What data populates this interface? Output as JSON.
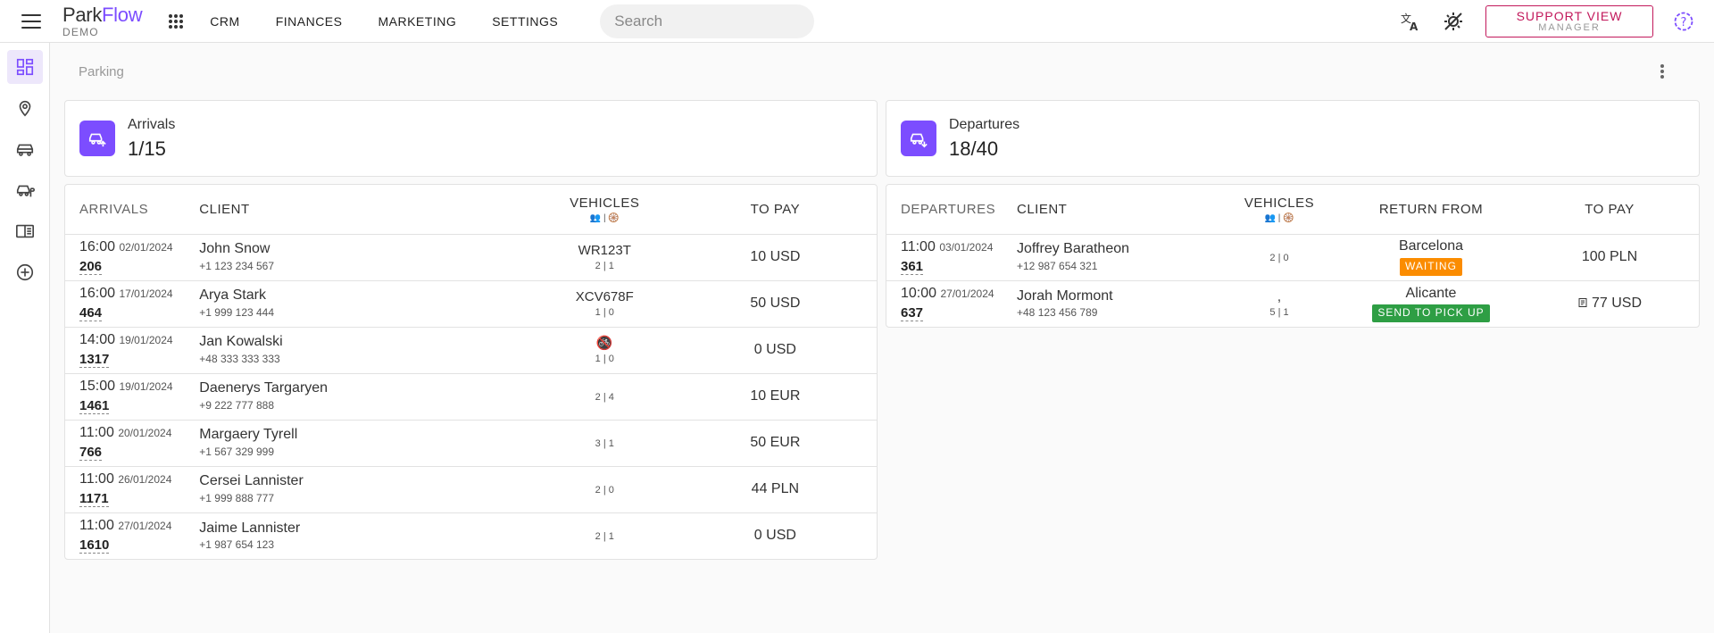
{
  "header": {
    "logo_part1": "Park",
    "logo_part2": "Flow",
    "logo_sub": "DEMO",
    "nav": [
      "CRM",
      "FINANCES",
      "MARKETING",
      "SETTINGS"
    ],
    "search_placeholder": "Search",
    "support_line1": "SUPPORT VIEW",
    "support_line2": "MANAGER"
  },
  "page": {
    "breadcrumb": "Parking"
  },
  "arrivals_stat": {
    "label": "Arrivals",
    "value": "1/15"
  },
  "departures_stat": {
    "label": "Departures",
    "value": "18/40"
  },
  "arrivals_table": {
    "columns": [
      "ARRIVALS",
      "CLIENT",
      "VEHICLES",
      "TO PAY"
    ],
    "vehicles_sub": "👥 | 🛞",
    "rows": [
      {
        "time": "16:00",
        "date": "02/01/2024",
        "number": "206",
        "client": "John Snow",
        "phone": "+1 123 234 567",
        "plate": "WR123T",
        "counts": "2 | 1",
        "pay": "10 USD"
      },
      {
        "time": "16:00",
        "date": "17/01/2024",
        "number": "464",
        "client": "Arya Stark",
        "phone": "+1 999 123 444",
        "plate": "XCV678F",
        "counts": "1 | 0",
        "pay": "50 USD"
      },
      {
        "time": "14:00",
        "date": "19/01/2024",
        "number": "1317",
        "client": "Jan Kowalski",
        "phone": "+48 333 333 333",
        "plate": "🚳",
        "counts": "1 | 0",
        "pay": "0 USD"
      },
      {
        "time": "15:00",
        "date": "19/01/2024",
        "number": "1461",
        "client": "Daenerys Targaryen",
        "phone": "+9 222 777 888",
        "plate": "",
        "counts": "2 | 4",
        "pay": "10 EUR"
      },
      {
        "time": "11:00",
        "date": "20/01/2024",
        "number": "766",
        "client": "Margaery Tyrell",
        "phone": "+1 567 329 999",
        "plate": "",
        "counts": "3 | 1",
        "pay": "50 EUR"
      },
      {
        "time": "11:00",
        "date": "26/01/2024",
        "number": "1171",
        "client": "Cersei Lannister",
        "phone": "+1 999 888 777",
        "plate": "",
        "counts": "2 | 0",
        "pay": "44 PLN"
      },
      {
        "time": "11:00",
        "date": "27/01/2024",
        "number": "1610",
        "client": "Jaime Lannister",
        "phone": "+1 987 654 123",
        "plate": "",
        "counts": "2 | 1",
        "pay": "0 USD"
      }
    ]
  },
  "departures_table": {
    "columns": [
      "DEPARTURES",
      "CLIENT",
      "VEHICLES",
      "RETURN FROM",
      "TO PAY"
    ],
    "vehicles_sub": "👥 | 🛞",
    "rows": [
      {
        "time": "11:00",
        "date": "03/01/2024",
        "number": "361",
        "client": "Joffrey Baratheon",
        "phone": "+12 987 654 321",
        "plate": "",
        "counts": "2 | 0",
        "city": "Barcelona",
        "status": "WAITING",
        "status_color": "#fb8c00",
        "pay_icon": "",
        "pay": "100 PLN"
      },
      {
        "time": "10:00",
        "date": "27/01/2024",
        "number": "637",
        "client": "Jorah Mormont",
        "phone": "+48 123 456 789",
        "plate": ",",
        "counts": "5 | 1",
        "city": "Alicante",
        "status": "SEND TO PICK UP",
        "status_color": "#2e9e44",
        "pay_icon": "receipt-icon",
        "pay": "77 USD"
      }
    ]
  }
}
